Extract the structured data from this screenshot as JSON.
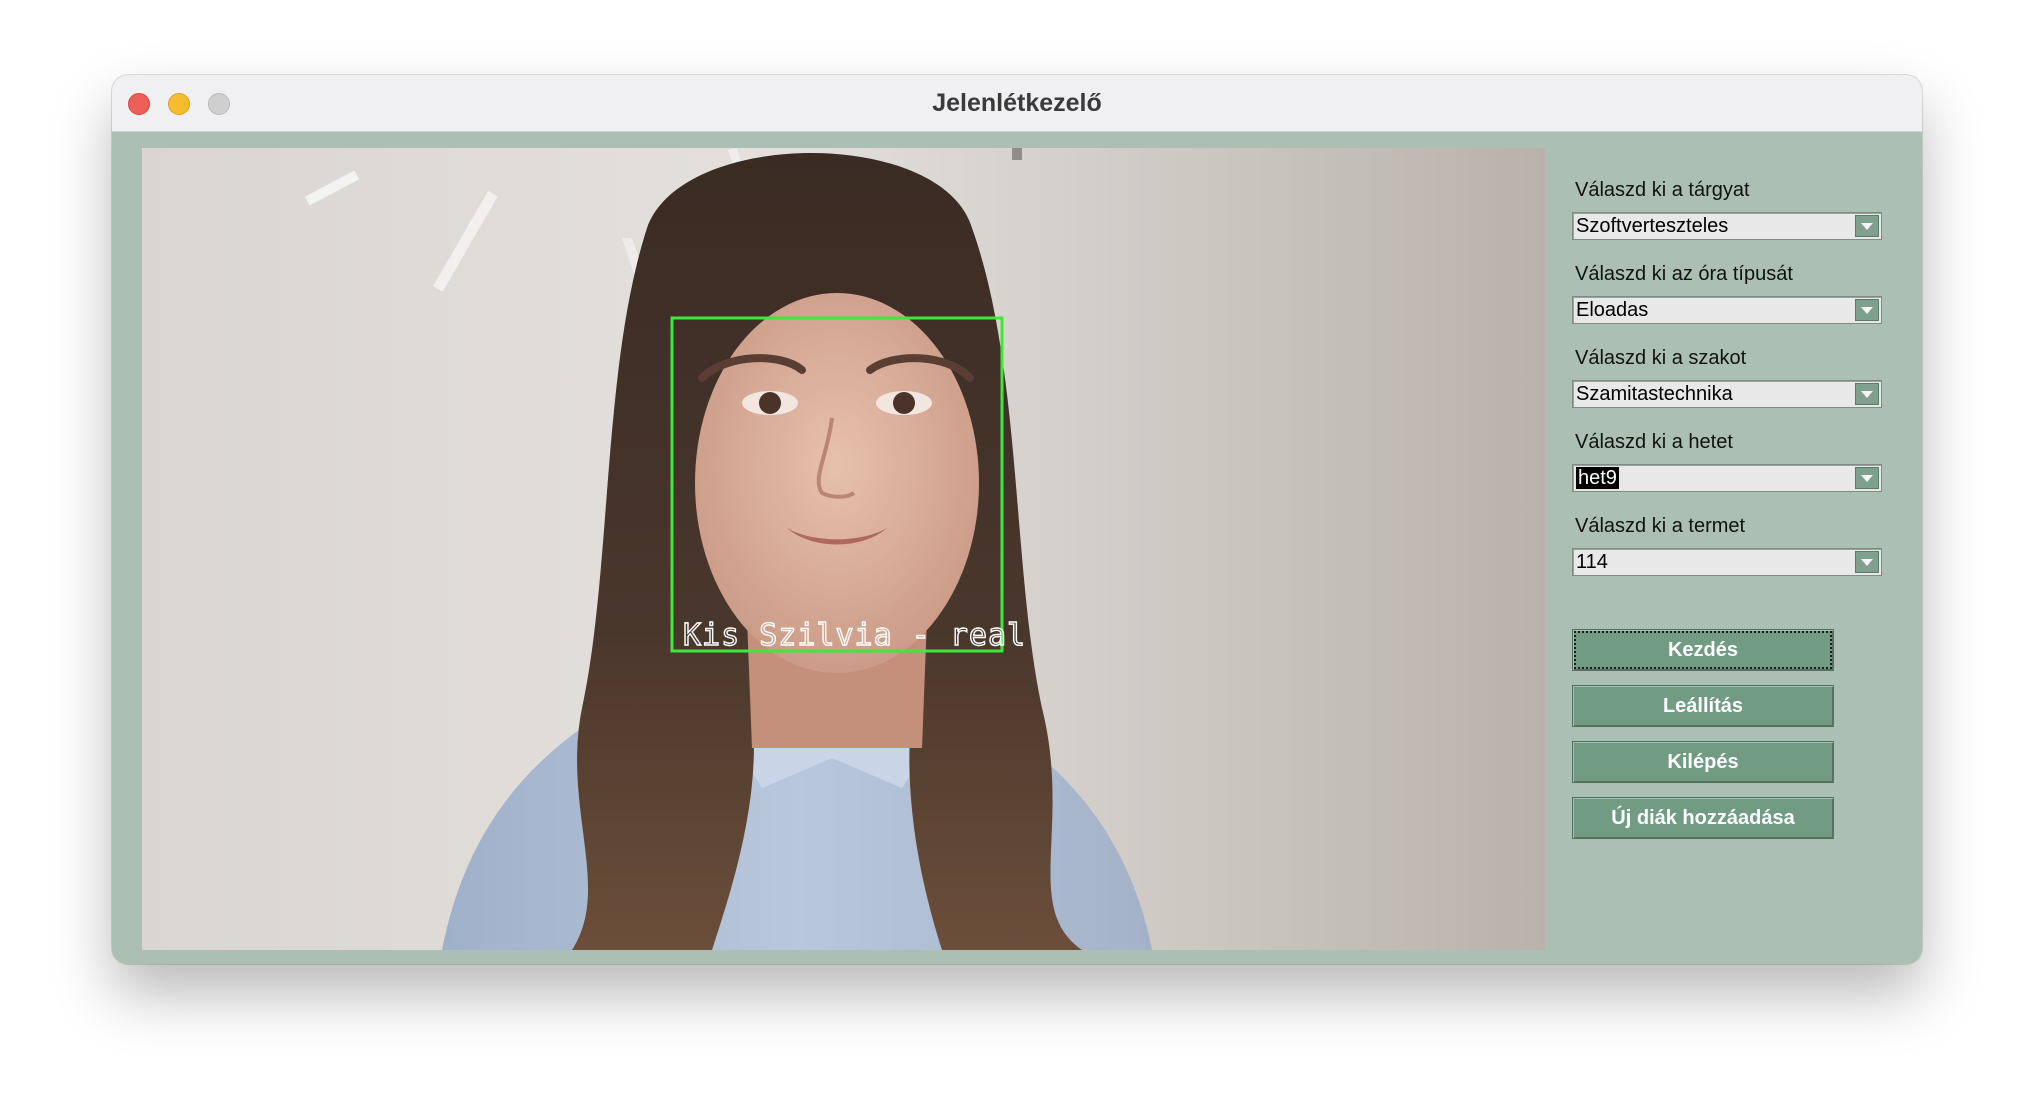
{
  "window": {
    "title": "Jelenlétkezelő"
  },
  "video": {
    "face_label": "Kis Szilvia - real",
    "box_color": "#3ee83a"
  },
  "form": {
    "subject": {
      "label": "Válaszd ki a tárgyat",
      "value": "Szoftverteszteles"
    },
    "class_type": {
      "label": "Válaszd ki az óra típusát",
      "value": "Eloadas"
    },
    "major": {
      "label": "Válaszd ki a szakot",
      "value": "Szamitastechnika"
    },
    "week": {
      "label": "Válaszd ki a hetet",
      "value": "het9"
    },
    "room": {
      "label": "Válaszd ki a termet",
      "value": "114"
    }
  },
  "buttons": {
    "start": "Kezdés",
    "stop": "Leállítás",
    "exit": "Kilépés",
    "add_student": "Új diák hozzáadása"
  },
  "colors": {
    "window_bg": "#abc0b3",
    "button_bg": "#719b83"
  }
}
